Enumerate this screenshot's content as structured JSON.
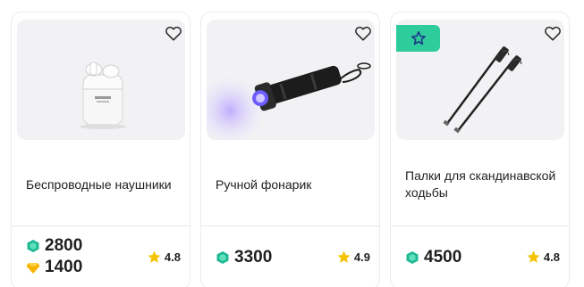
{
  "products": [
    {
      "name": "Беспроводные наушники",
      "price_gems": "2800",
      "price_coins": "1400",
      "rating": "4.8",
      "image_icon": "wireless-earbuds-case"
    },
    {
      "name": "Ручной фонарик",
      "price_gems": "3300",
      "rating": "4.9",
      "image_icon": "flashlight"
    },
    {
      "name": "Палки для скандинавской ходьбы",
      "price_gems": "4500",
      "rating": "4.8",
      "image_icon": "walking-poles",
      "badge_icon": "star-outline-icon"
    }
  ],
  "colors": {
    "gem": "#1fb894",
    "coin": "#f5b400",
    "star": "#f5c400",
    "badge": "#2ecc9b",
    "badge_star": "#1e3a8a"
  }
}
